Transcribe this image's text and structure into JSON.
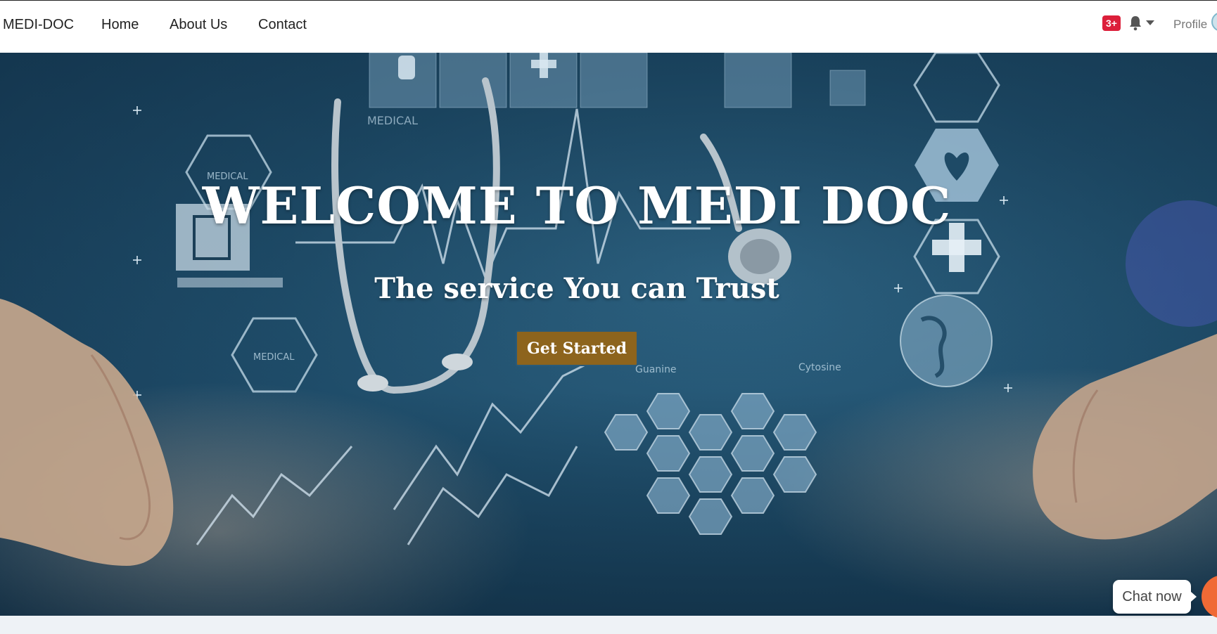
{
  "navbar": {
    "brand": "MEDI-DOC",
    "links": [
      {
        "label": "Home"
      },
      {
        "label": "About Us"
      },
      {
        "label": "Contact"
      }
    ],
    "notifications": {
      "badge": "3+",
      "icon": "bell-icon"
    },
    "profile_label": "Profile"
  },
  "hero": {
    "title": "WELCOME TO MEDI DOC",
    "subtitle": "The service You can Trust",
    "cta_label": "Get Started",
    "background_labels": [
      "MEDICAL",
      "MEDICAL",
      "MEDICAL",
      "Guanine",
      "Cytosine"
    ]
  },
  "chat": {
    "label": "Chat now"
  },
  "colors": {
    "hero_bg": "#1f4d6a",
    "cta_bg": "#8d641d",
    "badge_bg": "#dc1f3a",
    "chat_launcher": "#f06a35"
  }
}
